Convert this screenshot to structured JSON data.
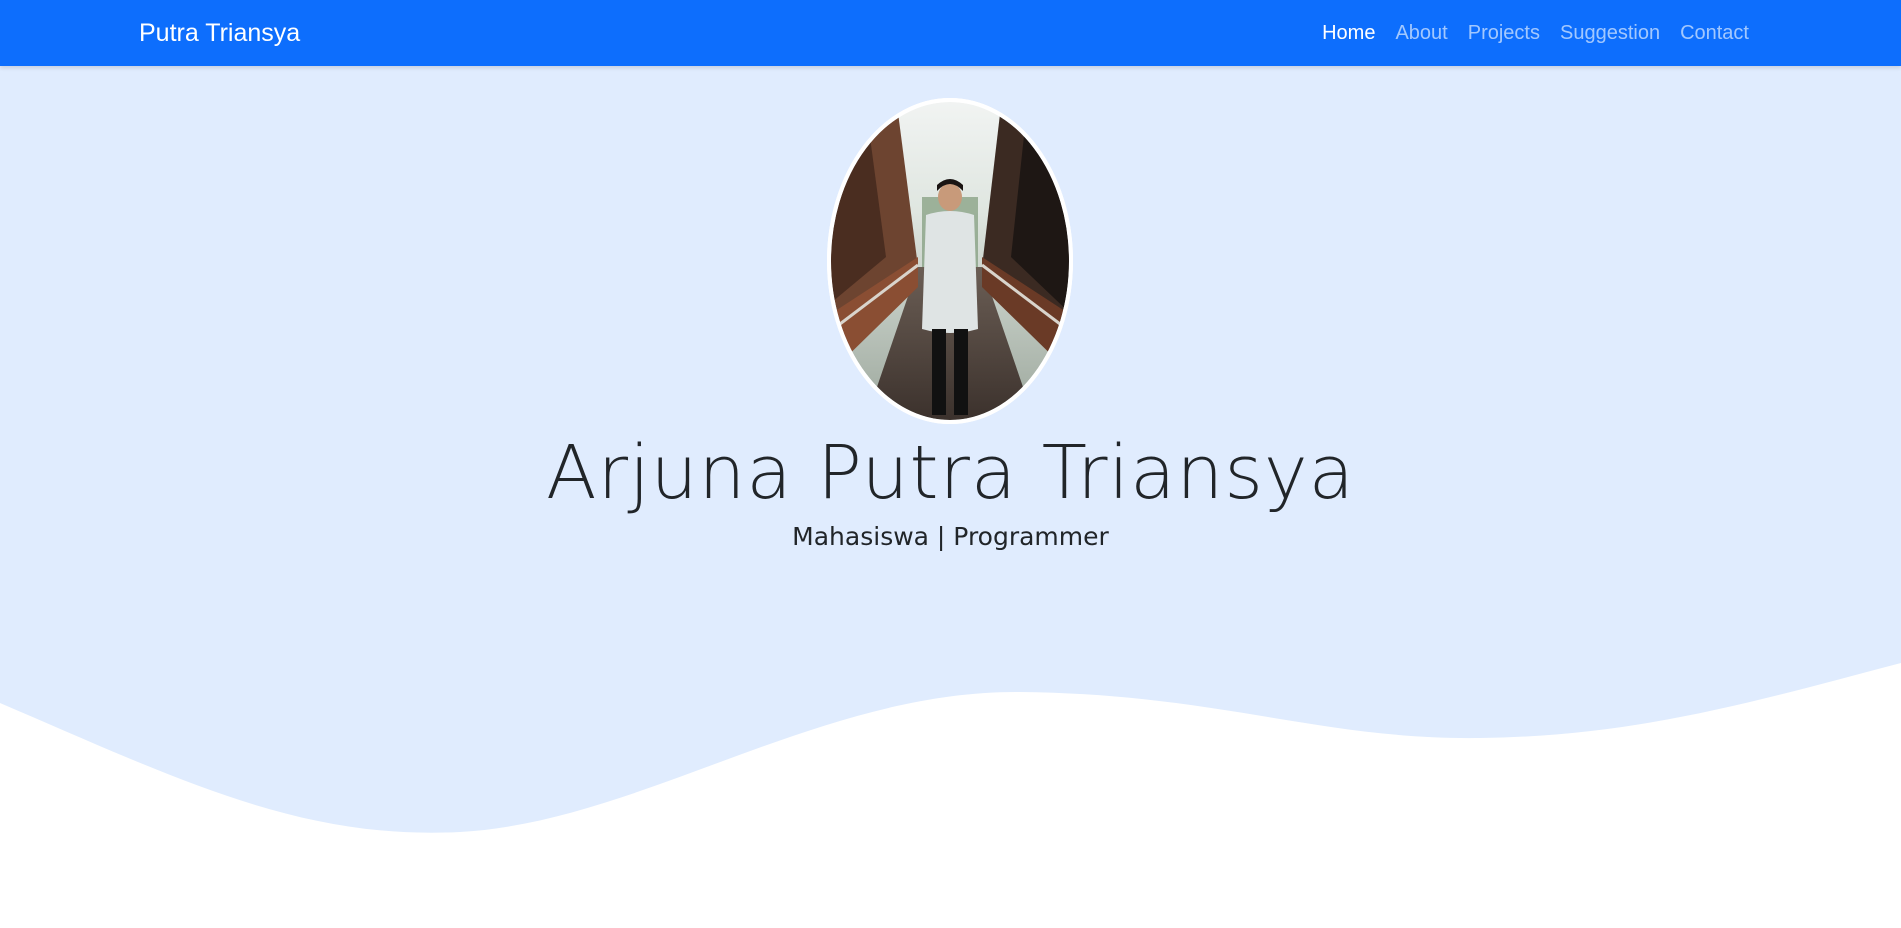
{
  "navbar": {
    "brand": "Putra Triansya",
    "links": [
      {
        "label": "Home",
        "active": true
      },
      {
        "label": "About",
        "active": false
      },
      {
        "label": "Projects",
        "active": false
      },
      {
        "label": "Suggestion",
        "active": false
      },
      {
        "label": "Contact",
        "active": false
      }
    ]
  },
  "hero": {
    "name": "Arjuna Putra Triansya",
    "subtitle": "Mahasiswa | Programmer",
    "avatar_icon": "profile-photo"
  },
  "colors": {
    "navbar_bg": "#0d6efd",
    "hero_bg": "#e0ecfe",
    "wave_fill": "#ffffff",
    "text_dark": "#212529"
  }
}
